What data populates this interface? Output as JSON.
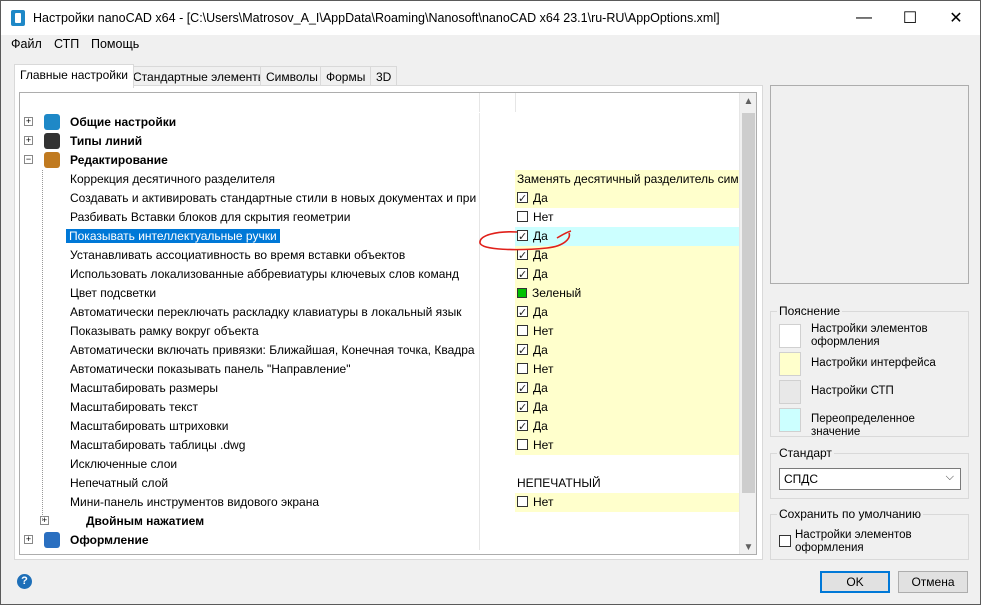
{
  "window": {
    "title": "Настройки nanoCAD x64 - [C:\\Users\\Matrosov_A_I\\AppData\\Roaming\\Nanosoft\\nanoCAD x64 23.1\\ru-RU\\AppOptions.xml]",
    "minimize": "—",
    "maximize": "☐",
    "close": "✕"
  },
  "menu": [
    "Файл",
    "СТП",
    "Помощь"
  ],
  "tabs": [
    "Главные настройки",
    "Стандартные элементы",
    "Символы",
    "Формы",
    "3D"
  ],
  "tree": {
    "categories_top": [
      {
        "label": "Общие настройки",
        "icon": "general-settings-icon",
        "expander": "+"
      },
      {
        "label": "Типы линий",
        "icon": "linetypes-icon",
        "expander": "+"
      },
      {
        "label": "Редактирование",
        "icon": "editing-icon",
        "expander": "−"
      }
    ],
    "rows": [
      {
        "label": "Коррекция десятичного разделителя",
        "value": "Заменять десятичный разделитель симв",
        "kind": "text",
        "bg": "yellow"
      },
      {
        "label": "Создавать и активировать стандартные стили в новых документах и при с",
        "value": "Да",
        "kind": "check",
        "checked": true,
        "bg": "yellow"
      },
      {
        "label": "Разбивать Вставки блоков для скрытия геометрии",
        "value": "Нет",
        "kind": "check",
        "checked": false,
        "bg": "white"
      },
      {
        "label": "Показывать интеллектуальные ручки",
        "value": "Да",
        "kind": "check",
        "checked": true,
        "bg": "cyan",
        "selected": true
      },
      {
        "label": "Устанавливать ассоциативность во время вставки объектов",
        "value": "Да",
        "kind": "check",
        "checked": true,
        "bg": "yellow"
      },
      {
        "label": "Использовать локализованные аббревиатуры ключевых слов команд",
        "value": "Да",
        "kind": "check",
        "checked": true,
        "bg": "yellow"
      },
      {
        "label": "Цвет подсветки",
        "value": "Зеленый",
        "kind": "color",
        "color": "#00c000",
        "bg": "yellow"
      },
      {
        "label": "Автоматически переключать раскладку клавиатуры в локальный язык",
        "value": "Да",
        "kind": "check",
        "checked": true,
        "bg": "yellow"
      },
      {
        "label": "Показывать рамку вокруг объекта",
        "value": "Нет",
        "kind": "check",
        "checked": false,
        "bg": "yellow"
      },
      {
        "label": "Автоматически включать привязки: Ближайшая, Конечная точка, Квадра",
        "value": "Да",
        "kind": "check",
        "checked": true,
        "bg": "yellow"
      },
      {
        "label": "Автоматически показывать панель \"Направление\"",
        "value": "Нет",
        "kind": "check",
        "checked": false,
        "bg": "yellow"
      },
      {
        "label": "Масштабировать размеры",
        "value": "Да",
        "kind": "check",
        "checked": true,
        "bg": "yellow"
      },
      {
        "label": "Масштабировать текст",
        "value": "Да",
        "kind": "check",
        "checked": true,
        "bg": "yellow"
      },
      {
        "label": "Масштабировать штриховки",
        "value": "Да",
        "kind": "check",
        "checked": true,
        "bg": "yellow"
      },
      {
        "label": "Масштабировать таблицы .dwg",
        "value": "Нет",
        "kind": "check",
        "checked": false,
        "bg": "yellow"
      },
      {
        "label": "Исключенные слои",
        "value": "",
        "kind": "text",
        "bg": "white"
      },
      {
        "label": "Непечатный слой",
        "value": "НЕПЕЧАТНЫЙ",
        "kind": "text",
        "bg": "white"
      },
      {
        "label": "Мини-панель инструментов видового экрана",
        "value": "Нет",
        "kind": "check",
        "checked": false,
        "bg": "yellow"
      }
    ],
    "sub_category": {
      "label": "Двойным нажатием",
      "expander": "+"
    },
    "categories_bottom": [
      {
        "label": "Оформление",
        "icon": "design-icon",
        "expander": "+"
      }
    ]
  },
  "legend": {
    "title": "Пояснение",
    "items": [
      {
        "label": "Настройки элементов оформления",
        "color": "#ffffff"
      },
      {
        "label": "Настройки интерфейса",
        "color": "#ffffcc"
      },
      {
        "label": "Настройки СТП",
        "color": "#e8e8e8"
      },
      {
        "label": "Переопределенное значение",
        "color": "#ccffff"
      }
    ]
  },
  "standard": {
    "title": "Стандарт",
    "value": "СПДС"
  },
  "save_default": {
    "title": "Сохранить по умолчанию",
    "checkbox_label": "Настройки элементов оформления",
    "checked": false
  },
  "buttons": {
    "ok": "OK",
    "cancel": "Отмена"
  },
  "help": "?",
  "colors": {
    "selection": "#0078d7",
    "interface": "#ffffcc",
    "overridden": "#ccffff",
    "annotation": "#e0201a"
  }
}
